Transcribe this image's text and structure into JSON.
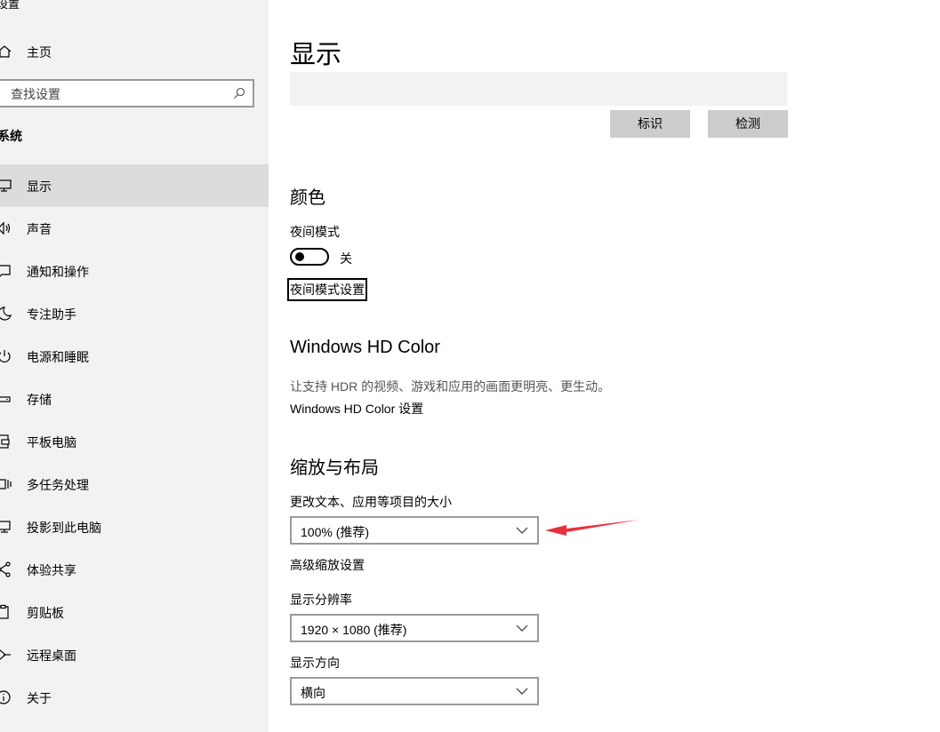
{
  "sidebar": {
    "app_title": "设置",
    "home_label": "主页",
    "search_placeholder": "查找设置",
    "section_label": "系统",
    "items": [
      {
        "label": "显示",
        "icon": "monitor-icon"
      },
      {
        "label": "声音",
        "icon": "speaker-icon"
      },
      {
        "label": "通知和操作",
        "icon": "notification-icon"
      },
      {
        "label": "专注助手",
        "icon": "moon-icon"
      },
      {
        "label": "电源和睡眠",
        "icon": "power-icon"
      },
      {
        "label": "存储",
        "icon": "storage-icon"
      },
      {
        "label": "平板电脑",
        "icon": "tablet-icon"
      },
      {
        "label": "多任务处理",
        "icon": "multitask-icon"
      },
      {
        "label": "投影到此电脑",
        "icon": "project-icon"
      },
      {
        "label": "体验共享",
        "icon": "share-icon"
      },
      {
        "label": "剪贴板",
        "icon": "clipboard-icon"
      },
      {
        "label": "远程桌面",
        "icon": "remote-icon"
      },
      {
        "label": "关于",
        "icon": "info-icon"
      }
    ]
  },
  "main": {
    "title": "显示",
    "identify_button": "标识",
    "detect_button": "检测",
    "color": {
      "heading": "颜色",
      "night_light_label": "夜间模式",
      "night_light_state": "关",
      "night_light_settings": "夜间模式设置"
    },
    "hdr": {
      "heading": "Windows HD Color",
      "description": "让支持 HDR 的视频、游戏和应用的画面更明亮、更生动。",
      "settings_link": "Windows HD Color 设置"
    },
    "scale": {
      "heading": "缩放与布局",
      "scale_label": "更改文本、应用等项目的大小",
      "scale_value": "100% (推荐)",
      "advanced_link": "高级缩放设置",
      "resolution_label": "显示分辨率",
      "resolution_value": "1920 × 1080 (推荐)",
      "orientation_label": "显示方向",
      "orientation_value": "横向"
    }
  },
  "colors": {
    "sidebar_bg": "#f2f2f2",
    "active_item_bg": "#dcdcdc",
    "button_bg": "#cccccc",
    "annotation_arrow": "#e8303a"
  }
}
